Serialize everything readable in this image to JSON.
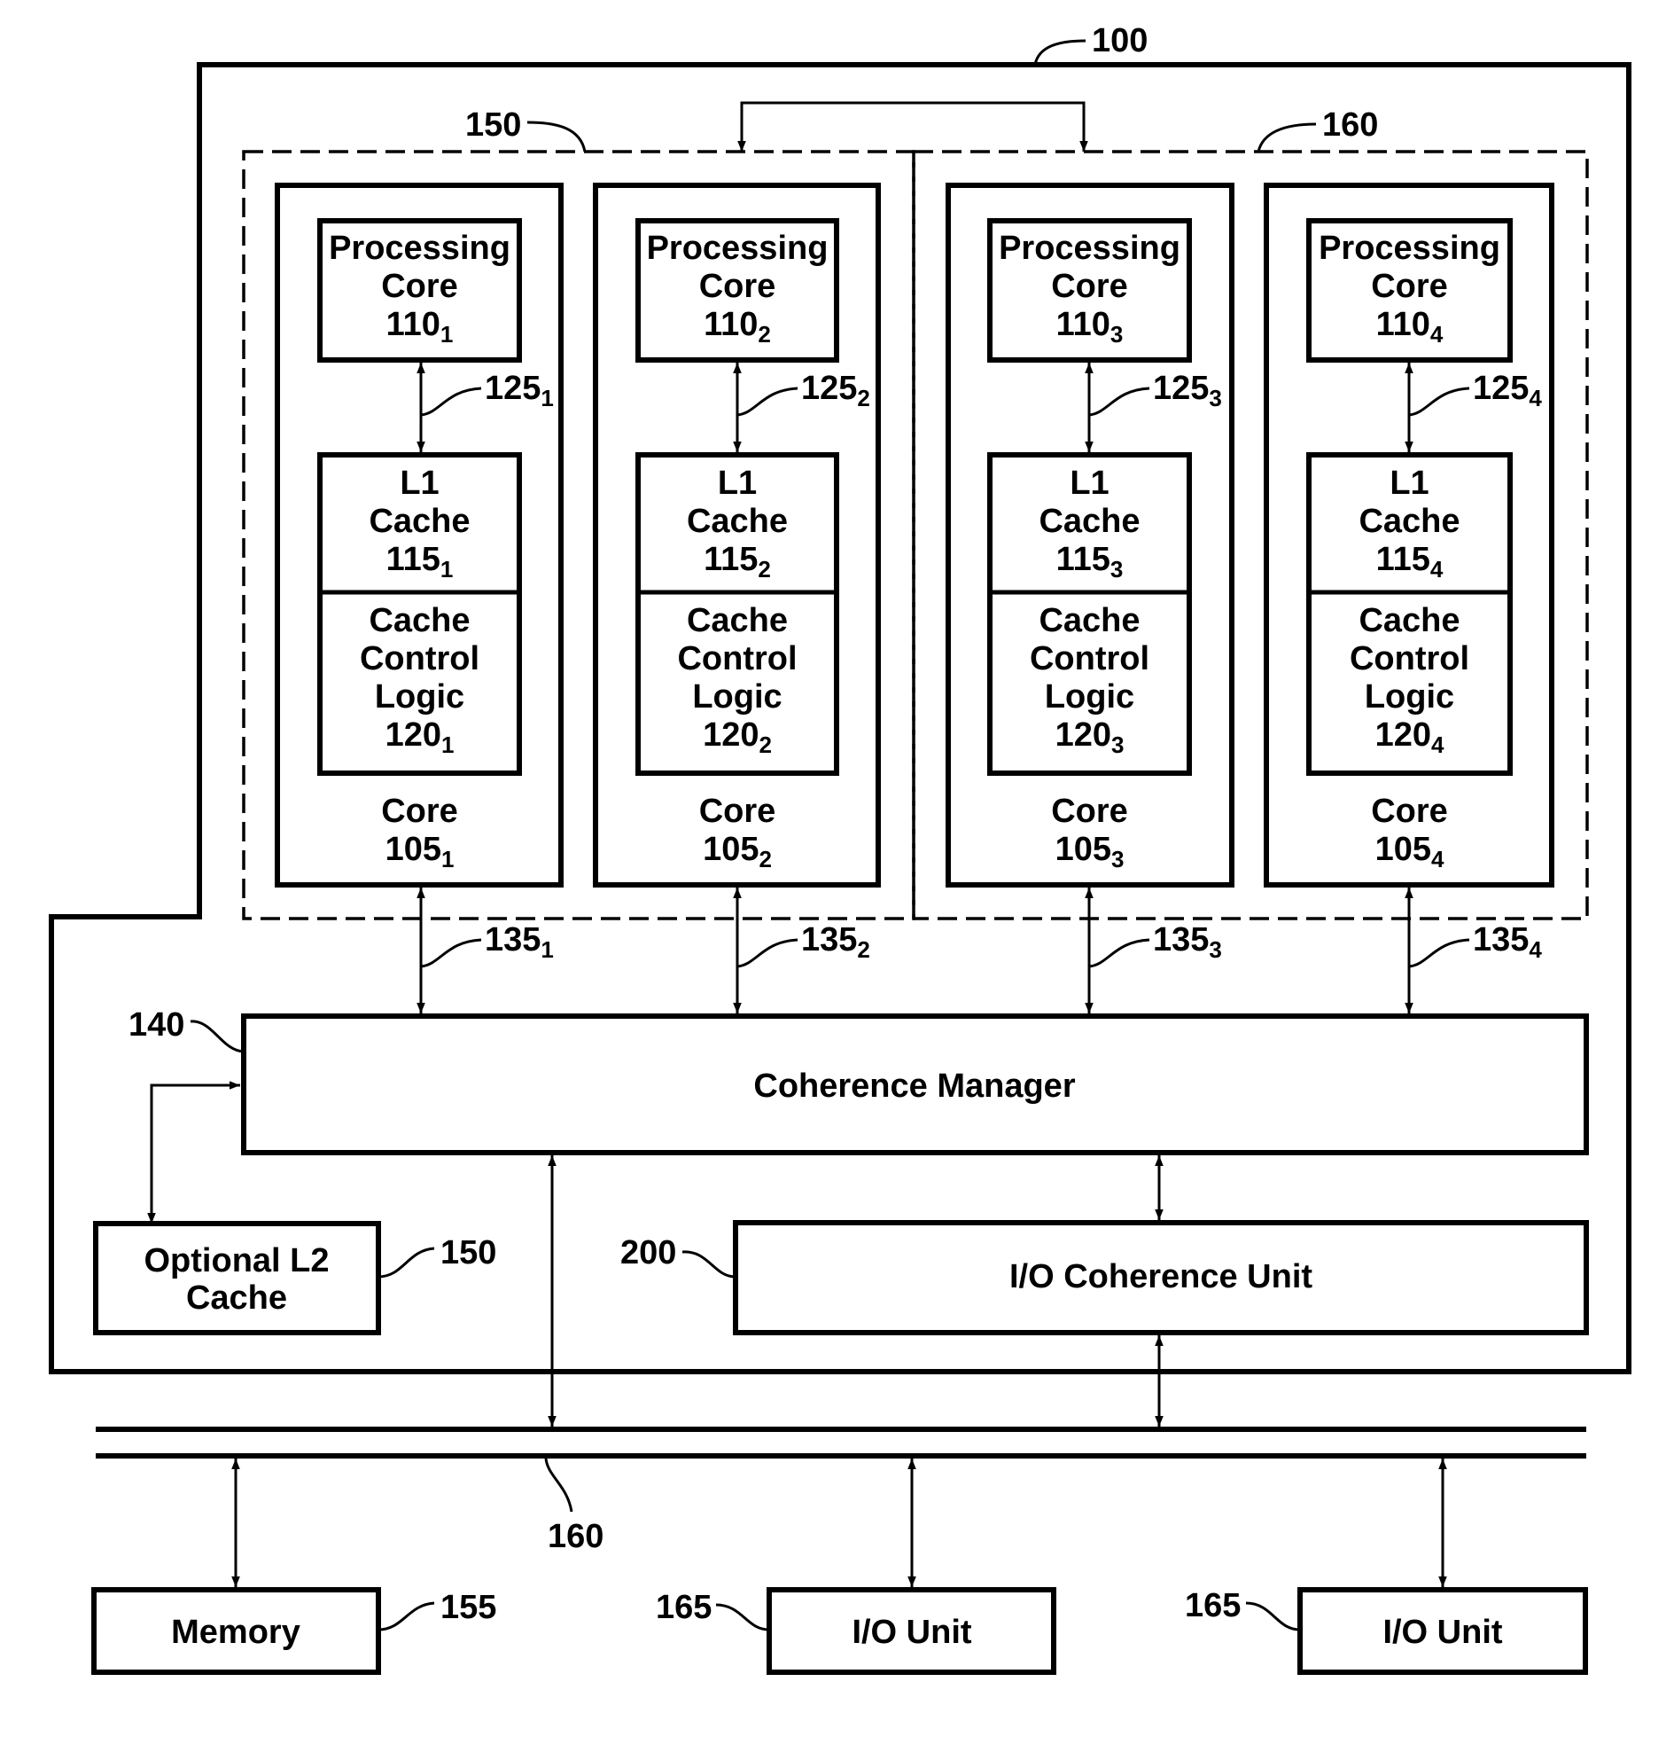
{
  "figure": {
    "system_ref": "100",
    "cluster_left_ref": "150",
    "cluster_right_ref": "160",
    "colors": {
      "ink": "#000000",
      "background": "#ffffff"
    }
  },
  "cores": [
    {
      "processing": [
        "Processing",
        "Core"
      ],
      "proc_ref": "110",
      "l1": [
        "L1",
        "Cache"
      ],
      "l1_ref": "115",
      "ccl": [
        "Cache",
        "Control",
        "Logic"
      ],
      "ccl_ref": "120",
      "core_label": "Core",
      "core_ref": "105",
      "link_ref": "125",
      "bus_ref": "135",
      "sub": "1"
    },
    {
      "processing": [
        "Processing",
        "Core"
      ],
      "proc_ref": "110",
      "l1": [
        "L1",
        "Cache"
      ],
      "l1_ref": "115",
      "ccl": [
        "Cache",
        "Control",
        "Logic"
      ],
      "ccl_ref": "120",
      "core_label": "Core",
      "core_ref": "105",
      "link_ref": "125",
      "bus_ref": "135",
      "sub": "2"
    },
    {
      "processing": [
        "Processing",
        "Core"
      ],
      "proc_ref": "110",
      "l1": [
        "L1",
        "Cache"
      ],
      "l1_ref": "115",
      "ccl": [
        "Cache",
        "Control",
        "Logic"
      ],
      "ccl_ref": "120",
      "core_label": "Core",
      "core_ref": "105",
      "link_ref": "125",
      "bus_ref": "135",
      "sub": "3"
    },
    {
      "processing": [
        "Processing",
        "Core"
      ],
      "proc_ref": "110",
      "l1": [
        "L1",
        "Cache"
      ],
      "l1_ref": "115",
      "ccl": [
        "Cache",
        "Control",
        "Logic"
      ],
      "ccl_ref": "120",
      "core_label": "Core",
      "core_ref": "105",
      "link_ref": "125",
      "bus_ref": "135",
      "sub": "4"
    }
  ],
  "coherence_manager": {
    "label": "Coherence Manager",
    "ref": "140"
  },
  "l2_cache": {
    "lines": [
      "Optional L2",
      "Cache"
    ],
    "ref": "150"
  },
  "io_coherence_unit": {
    "label": "I/O Coherence Unit",
    "ref": "200"
  },
  "bus": {
    "ref": "160"
  },
  "memory": {
    "label": "Memory",
    "ref": "155"
  },
  "io_units": [
    {
      "label": "I/O Unit",
      "ref": "165"
    },
    {
      "label": "I/O Unit",
      "ref": "165"
    }
  ]
}
